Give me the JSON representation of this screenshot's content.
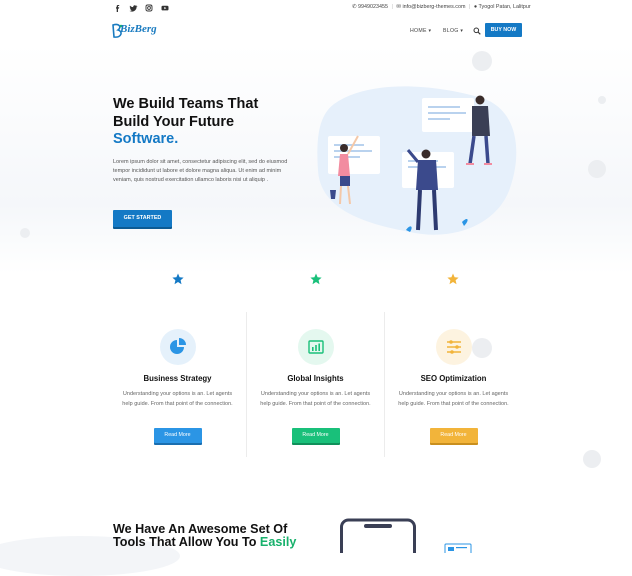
{
  "topbar": {
    "social": [
      "facebook-icon",
      "twitter-icon",
      "instagram-icon",
      "youtube-icon"
    ],
    "phone": "9949023455",
    "email": "info@bizberg-themes.com",
    "address": "Tyogol Patan, Lalitpur"
  },
  "nav": {
    "logo": "BizBerg",
    "items": [
      "HOME",
      "BLOG"
    ],
    "buy_label": "BUY NOW"
  },
  "hero": {
    "title_line1": "We Build Teams That",
    "title_line2": "Build Your Future",
    "title_accent": "Software.",
    "body": "Lorem ipsum dolor sit amet, consectetur adipiscing elit, sed do eiusmod tempor incididunt ut labore et dolore magna aliqua. Ut enim ad minim veniam, quis nostrud exercitation ullamco laboris nisi ut aliquip .",
    "cta_label": "GET STARTED"
  },
  "features": [
    {
      "title": "Business Strategy",
      "text": "Understanding your options is an. Let agents help guide. From that point of the connection.",
      "button": "Read More",
      "color": "#2b95e5",
      "bg": "#e5f1fb"
    },
    {
      "title": "Global Insights",
      "text": "Understanding your options is an. Let agents help guide. From that point of the connection.",
      "button": "Read More",
      "color": "#19c07a",
      "bg": "#e4f8ef"
    },
    {
      "title": "SEO Optimization",
      "text": "Understanding your options is an. Let agents help guide. From that point of the connection.",
      "button": "Read More",
      "color": "#f2b43a",
      "bg": "#fdf3e0"
    }
  ],
  "section2": {
    "line1": "We Have An Awesome Set Of",
    "line2": "Tools That Allow You To",
    "accent": "Easily"
  },
  "colors": {
    "primary": "#1479c5",
    "green": "#18b16c",
    "orange": "#f2b43a"
  }
}
